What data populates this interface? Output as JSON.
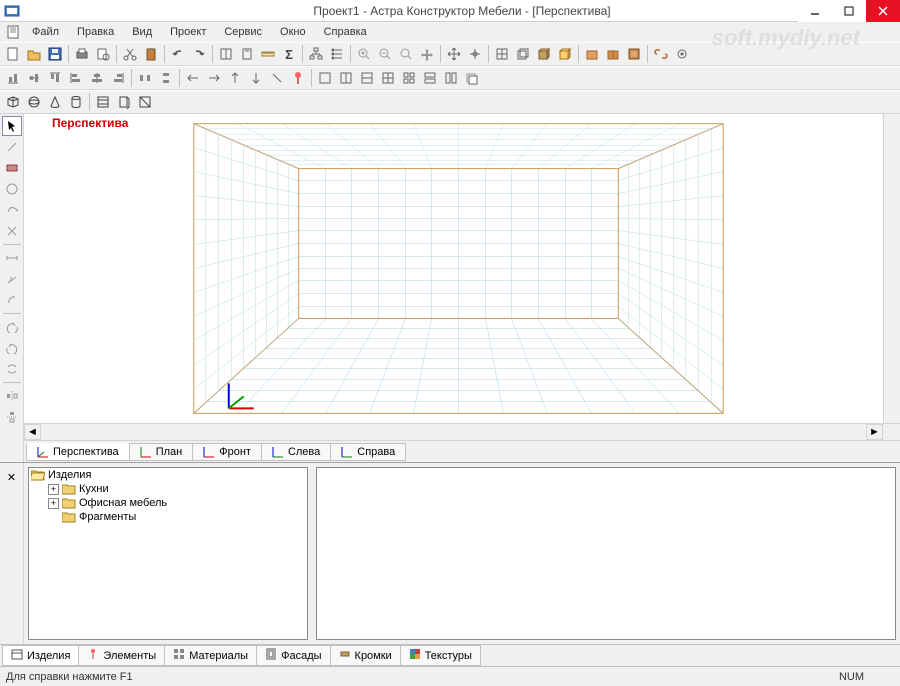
{
  "window": {
    "title": "Проект1 - Астра Конструктор Мебели - [Перспектива]"
  },
  "watermark": "soft.mydiy.net",
  "menu": {
    "items": [
      "Файл",
      "Правка",
      "Вид",
      "Проект",
      "Сервис",
      "Окно",
      "Справка"
    ]
  },
  "viewport": {
    "label": "Перспектива"
  },
  "viewTabs": [
    {
      "label": "Перспектива"
    },
    {
      "label": "План"
    },
    {
      "label": "Фронт"
    },
    {
      "label": "Слева"
    },
    {
      "label": "Справа"
    }
  ],
  "tree": {
    "root": {
      "label": "Изделия"
    },
    "children": [
      {
        "label": "Кухни",
        "expandable": true
      },
      {
        "label": "Офисная мебель",
        "expandable": true
      },
      {
        "label": "Фрагменты",
        "expandable": false
      }
    ]
  },
  "bottomTabs": [
    {
      "label": "Изделия"
    },
    {
      "label": "Элементы"
    },
    {
      "label": "Материалы"
    },
    {
      "label": "Фасады"
    },
    {
      "label": "Кромки"
    },
    {
      "label": "Текстуры"
    }
  ],
  "status": {
    "hint": "Для справки нажмите F1",
    "indicator": "NUM"
  }
}
